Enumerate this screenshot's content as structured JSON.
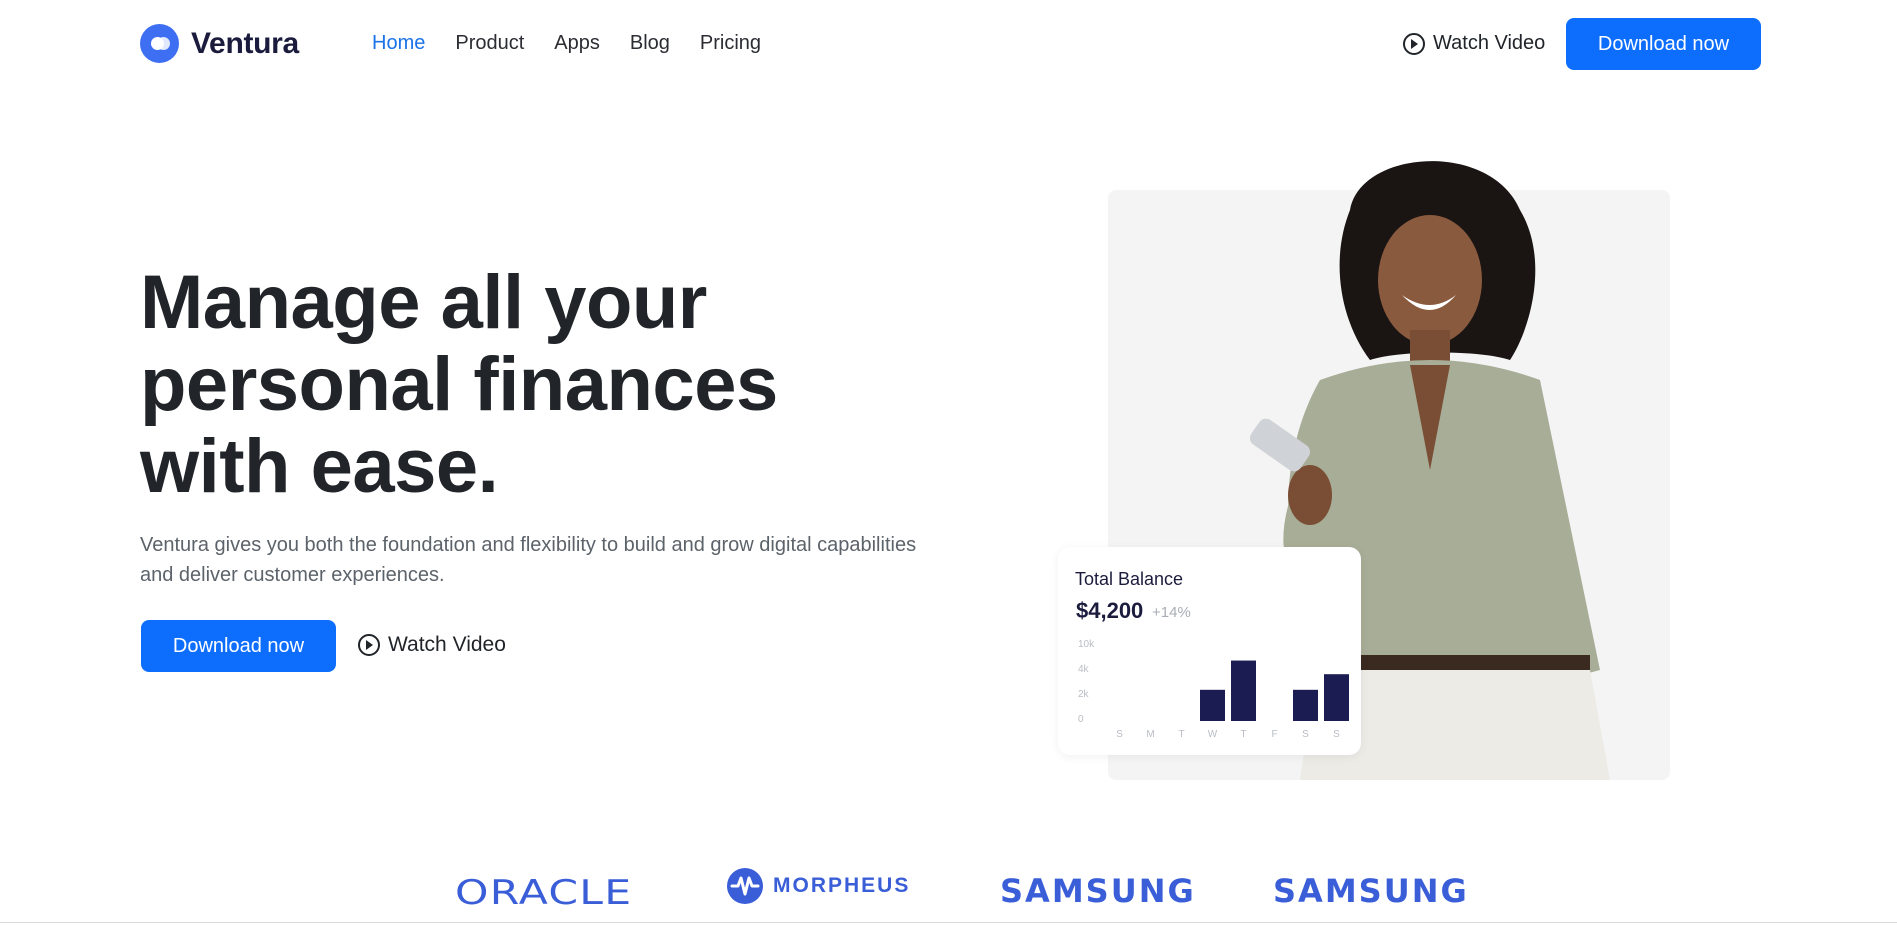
{
  "nav": {
    "brand": "Ventura",
    "links": [
      "Home",
      "Product",
      "Apps",
      "Blog",
      "Pricing"
    ],
    "active_link": "Home",
    "watch_video": "Watch Video",
    "download": "Download now"
  },
  "hero": {
    "title_line1": "Manage all your",
    "title_line2": "personal finances",
    "title_line3": "with ease.",
    "subtitle_line1": "Ventura gives you both the foundation and flexibility to build and grow digital capabilities",
    "subtitle_line2": "and deliver customer experiences.",
    "download": "Download now",
    "watch_video": "Watch Video"
  },
  "balance_card": {
    "title": "Total Balance",
    "amount": "$4,200",
    "change": "+14%"
  },
  "chart_data": {
    "type": "bar",
    "categories": [
      "S",
      "M",
      "T",
      "W",
      "T",
      "F",
      "S",
      "S"
    ],
    "values": [
      0,
      0,
      0,
      3.2,
      6.2,
      0,
      3.2,
      4.8
    ],
    "y_ticks": [
      "10k",
      "4k",
      "2k",
      "0"
    ],
    "bar_color": "#1b1c52"
  },
  "logos": {
    "oracle": "ORACLE",
    "morpheus": "MORPHEUS",
    "samsung_1": "SAMSUNG",
    "samsung_2": "SAMSUNG"
  },
  "colors": {
    "primary": "#0d6efd",
    "brand_blue": "#3e6ff2",
    "logo_blue": "#3a5ed8",
    "heading": "#212529"
  }
}
